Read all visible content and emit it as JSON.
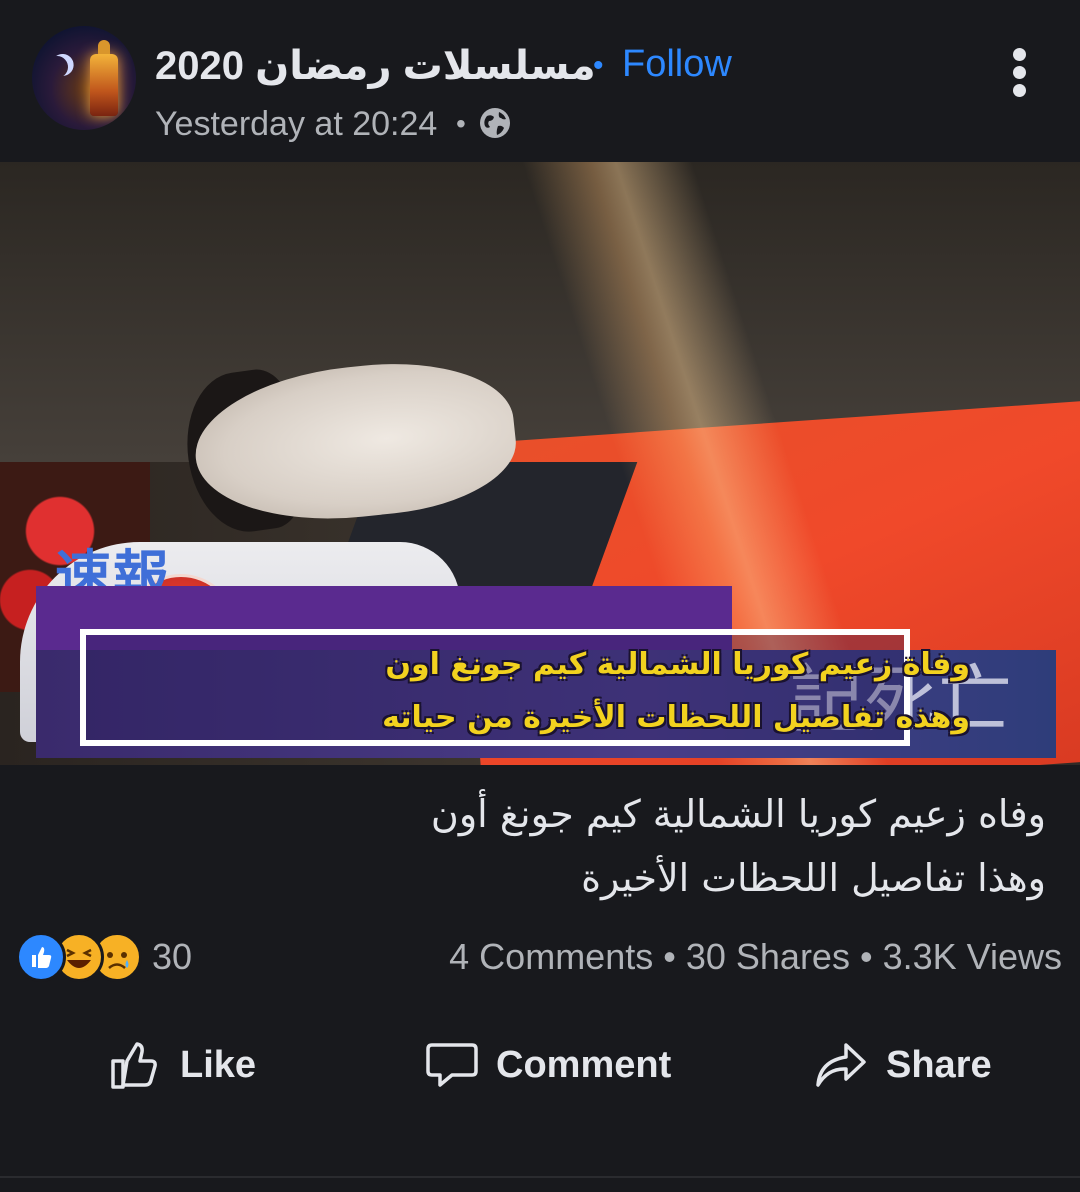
{
  "header": {
    "page_name": "مسلسلات رمضان 2020",
    "follow_label": "Follow",
    "separator": "•",
    "timestamp": "Yesterday at 20:24",
    "privacy_icon": "globe-icon",
    "more_icon": "more-vertical-icon"
  },
  "media": {
    "tv_top_chars": "速報",
    "tv_right_chars": "記死亡",
    "caption_line_1": "وفاة زعيم كوريا الشمالية كيم جونغ اون",
    "caption_line_2": "وهذه تفاصيل اللحظات الأخيرة من حياته"
  },
  "post": {
    "text_line_1": "وفاه زعيم كوريا الشمالية كيم جونغ أون",
    "text_line_2": "وهذا تفاصيل اللحظات الأخيرة"
  },
  "engagement": {
    "reaction_icons": [
      "like-reaction-icon",
      "haha-reaction-icon",
      "sad-reaction-icon"
    ],
    "reaction_count": "30",
    "comments": "4 Comments",
    "shares": "30 Shares",
    "views": "3.3K Views",
    "separator": "•"
  },
  "actions": {
    "like_label": "Like",
    "comment_label": "Comment",
    "share_label": "Share"
  },
  "colors": {
    "background": "#18191d",
    "text_primary": "#e4e6eb",
    "text_secondary": "#b0b3b8",
    "accent_blue": "#2d88ff",
    "caption_yellow": "#f2d21f"
  }
}
